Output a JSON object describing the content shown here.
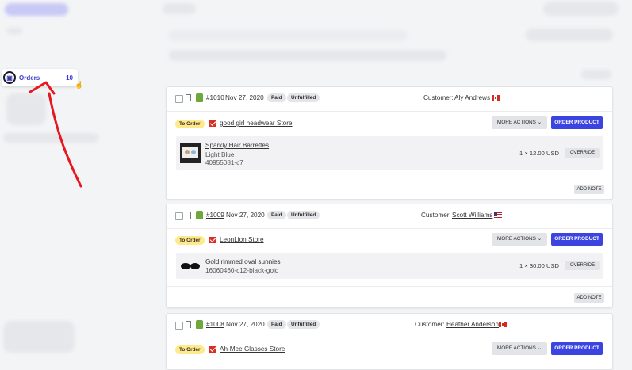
{
  "sidebar": {
    "orders_label": "Orders",
    "orders_count": "10"
  },
  "annotation": {
    "color": "#e8161e"
  },
  "orders": [
    {
      "number": "#1010",
      "date": "Nov 27, 2020",
      "paid": "Paid",
      "fulfillment": "Unfulfilled",
      "customer_label": "Customer:",
      "customer": "Aly Andrews",
      "flag": "ca-flag-icon",
      "to_order": "To Order",
      "store": "good girl headwear Store",
      "more_actions": "MORE ACTIONS",
      "order_product": "ORDER PRODUCT",
      "item": {
        "name": "Sparkly Hair Barrettes",
        "variant": "Light Blue",
        "sku": "40955081-c7",
        "qty": "1 × 12.00 USD"
      },
      "override": "OVERRIDE",
      "add_note": "ADD NOTE"
    },
    {
      "number": "#1009",
      "date": "Nov 27, 2020",
      "paid": "Paid",
      "fulfillment": "Unfulfilled",
      "customer_label": "Customer:",
      "customer": "Scott Williams",
      "flag": "us-flag-icon",
      "to_order": "To Order",
      "store": "LeonLion Store",
      "more_actions": "MORE ACTIONS",
      "order_product": "ORDER PRODUCT",
      "item": {
        "name": "Gold rimmed oval sunnies",
        "variant": "16060460-c12-black-gold",
        "qty": "1 × 30.00 USD"
      },
      "override": "OVERRIDE",
      "add_note": "ADD NOTE"
    },
    {
      "number": "#1008",
      "date": "Nov 27, 2020",
      "paid": "Paid",
      "fulfillment": "Unfulfilled",
      "customer_label": "Customer:",
      "customer": "Heather Anderson",
      "flag": "ca-flag-icon",
      "to_order": "To Order",
      "store": "Ah-Mee Glasses Store",
      "more_actions": "MORE ACTIONS",
      "order_product": "ORDER PRODUCT"
    }
  ]
}
